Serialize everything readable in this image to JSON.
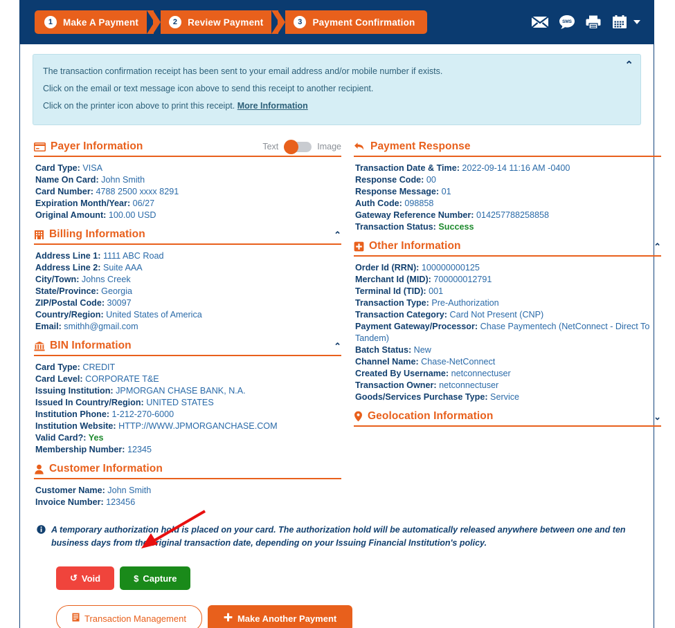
{
  "steps": [
    {
      "num": "1",
      "label": "Make A Payment"
    },
    {
      "num": "2",
      "label": "Review Payment"
    },
    {
      "num": "3",
      "label": "Payment Confirmation"
    }
  ],
  "topicons": [
    {
      "name": "email-icon",
      "glyph": "✉"
    },
    {
      "name": "sms-icon",
      "glyph": "SMS"
    },
    {
      "name": "printer-icon",
      "glyph": "⎙"
    },
    {
      "name": "calendar-icon",
      "glyph": "📅"
    }
  ],
  "banner": {
    "line1": "The transaction confirmation receipt has been sent to your email address and/or mobile number if exists.",
    "line2": "Click on the email or text message icon above to send this receipt to another recipient.",
    "line3_pre": "Click on the printer icon above to print this receipt. ",
    "line3_link": "More Information",
    "collapse": "⌃"
  },
  "payer": {
    "title": "Payer Information",
    "toggle_left": "Text",
    "toggle_right": "Image",
    "fields": [
      {
        "label": "Card Type:",
        "value": "VISA"
      },
      {
        "label": "Name On Card:",
        "value": "John Smith"
      },
      {
        "label": "Card Number:",
        "value": "4788 2500 xxxx 8291"
      },
      {
        "label": "Expiration Month/Year:",
        "value": "06/27"
      },
      {
        "label": "Original Amount:",
        "value": "100.00 USD"
      }
    ]
  },
  "billing": {
    "title": "Billing Information",
    "collapse": "⌃",
    "fields": [
      {
        "label": "Address Line 1:",
        "value": "1111 ABC Road"
      },
      {
        "label": "Address Line 2:",
        "value": "Suite AAA"
      },
      {
        "label": "City/Town:",
        "value": "Johns Creek"
      },
      {
        "label": "State/Province:",
        "value": "Georgia"
      },
      {
        "label": "ZIP/Postal Code:",
        "value": "30097"
      },
      {
        "label": "Country/Region:",
        "value": "United States of America"
      },
      {
        "label": "Email:",
        "value": "smithh@gmail.com"
      }
    ]
  },
  "bin": {
    "title": "BIN Information",
    "collapse": "⌃",
    "fields": [
      {
        "label": "Card Type:",
        "value": "CREDIT"
      },
      {
        "label": "Card Level:",
        "value": "CORPORATE T&E"
      },
      {
        "label": "Issuing Institution:",
        "value": "JPMORGAN CHASE BANK, N.A."
      },
      {
        "label": "Issued In Country/Region:",
        "value": "UNITED STATES"
      },
      {
        "label": "Institution Phone:",
        "value": "1-212-270-6000"
      },
      {
        "label": "Institution Website:",
        "value": "HTTP://WWW.JPMORGANCHASE.COM"
      },
      {
        "label": "Valid Card?:",
        "value": "Yes",
        "status": "ok"
      },
      {
        "label": "Membership Number:",
        "value": "12345"
      }
    ]
  },
  "customer": {
    "title": "Customer Information",
    "fields": [
      {
        "label": "Customer Name:",
        "value": "John Smith"
      },
      {
        "label": "Invoice Number:",
        "value": "123456"
      }
    ]
  },
  "response": {
    "title": "Payment Response",
    "fields": [
      {
        "label": "Transaction Date & Time:",
        "value": "2022-09-14 11:16 AM -0400"
      },
      {
        "label": "Response Code:",
        "value": "00"
      },
      {
        "label": "Response Message:",
        "value": "01"
      },
      {
        "label": "Auth Code:",
        "value": "098858"
      },
      {
        "label": "Gateway Reference Number:",
        "value": "014257788258858"
      },
      {
        "label": "Transaction Status:",
        "value": "Success",
        "status": "ok"
      }
    ]
  },
  "other": {
    "title": "Other Information",
    "collapse": "⌃",
    "fields": [
      {
        "label": "Order Id (RRN):",
        "value": "100000000125"
      },
      {
        "label": "Merchant Id (MID):",
        "value": "700000012791"
      },
      {
        "label": "Terminal Id (TID):",
        "value": "001"
      },
      {
        "label": "Transaction Type:",
        "value": "Pre-Authorization"
      },
      {
        "label": "Transaction Category:",
        "value": "Card Not Present (CNP)"
      },
      {
        "label": "Payment Gateway/Processor:",
        "value": "Chase Paymentech (NetConnect - Direct To Tandem)",
        "wrap": true
      },
      {
        "label": "Batch Status:",
        "value": "New"
      },
      {
        "label": "Channel Name:",
        "value": "Chase-NetConnect"
      },
      {
        "label": "Created By Username:",
        "value": "netconnectuser"
      },
      {
        "label": "Transaction Owner:",
        "value": "netconnectuser"
      },
      {
        "label": "Goods/Services Purchase Type:",
        "value": "Service"
      }
    ]
  },
  "geolocation": {
    "title": "Geolocation Information",
    "expand": "⌄"
  },
  "note": {
    "text": "A temporary authorization hold is placed on your card. The authorization hold will be automatically released anywhere between one and ten business days from the original transaction date, depending on your Issuing Financial Institution's policy."
  },
  "buttons": {
    "void": "Void",
    "void_icon": "↺",
    "capture": "Capture",
    "capture_icon": "$",
    "transaction_management": "Transaction Management",
    "make_another_payment": "Make Another Payment",
    "make_another_icon": "+"
  },
  "colors": {
    "navy": "#0b3b70",
    "orange": "#e8601c",
    "banner_bg": "#d6eef5",
    "success_green": "#1e8a2e",
    "void_red": "#f0443c",
    "capture_green": "#1a8a1a",
    "field_label": "#12406f",
    "field_value": "#2a6aa8"
  }
}
